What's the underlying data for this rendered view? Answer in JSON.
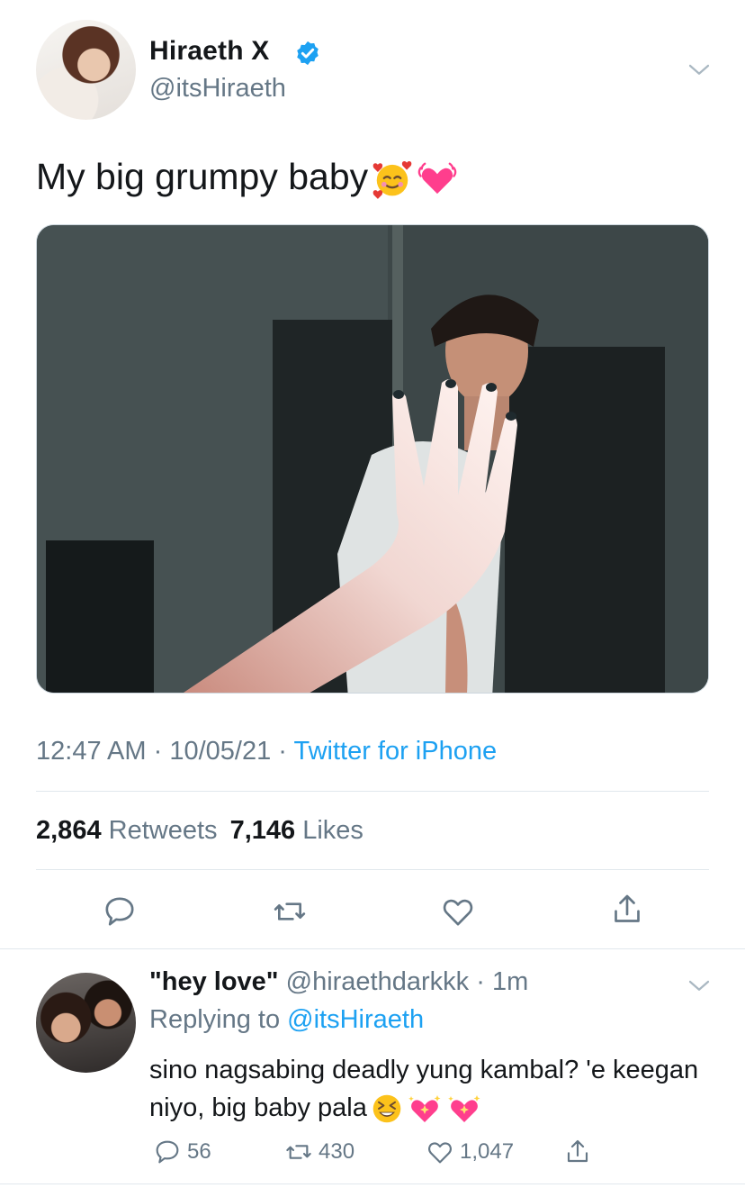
{
  "tweet": {
    "author_name": "Hiraeth X",
    "author_handle": "@itsHiraeth",
    "text": "My big grumpy baby",
    "time": "12:47 AM",
    "date": "10/05/21",
    "source": "Twitter for iPhone",
    "retweets_count": "2,864",
    "retweets_label": "Retweets",
    "likes_count": "7,146",
    "likes_label": "Likes"
  },
  "reply": {
    "author_name": "\"hey love\"",
    "author_handle": "@hiraethdarkkk",
    "age": "1m",
    "replying_prefix": "Replying to",
    "replying_to": "@itsHiraeth",
    "text": "sino nagsabing deadly yung kambal? 'e keegan niyo, big baby pala",
    "reply_count": "56",
    "retweet_count": "430",
    "like_count": "1,047"
  },
  "colors": {
    "accent": "#1da1f2",
    "secondary_text": "#657786",
    "primary_text": "#14171a"
  }
}
